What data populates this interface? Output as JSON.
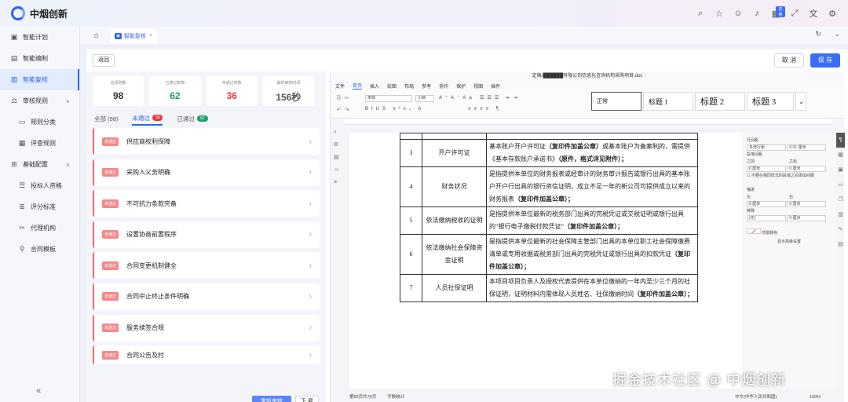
{
  "app": {
    "name": "中烟创新"
  },
  "header_icons": [
    "search-icon",
    "settings-icon",
    "chat-icon",
    "bell-icon",
    "apps-icon",
    "fullscreen-icon",
    "translate-icon",
    "gear-icon"
  ],
  "header_badge": "应用",
  "sidebar": {
    "items": [
      {
        "label": "智能计划",
        "icon": "book-icon"
      },
      {
        "label": "智能编制",
        "icon": "edit-icon"
      },
      {
        "label": "智能复核",
        "icon": "check-icon",
        "active": true
      },
      {
        "label": "审核规则",
        "icon": "rule-icon",
        "group": true
      },
      {
        "label": "规则分类",
        "icon": "list-icon",
        "sub": true
      },
      {
        "label": "评查规则",
        "icon": "doc-icon",
        "sub": true
      },
      {
        "label": "基础配置",
        "icon": "config-icon",
        "group": true
      },
      {
        "label": "投标人资格",
        "icon": "user-icon",
        "sub": true
      },
      {
        "label": "评分标准",
        "icon": "score-icon",
        "sub": true
      },
      {
        "label": "代理机构",
        "icon": "agency-icon",
        "sub": true
      },
      {
        "label": "合同模板",
        "icon": "contract-icon",
        "sub": true
      }
    ],
    "collapse_glyph": "«"
  },
  "tabs": [
    {
      "label": "智能复核"
    }
  ],
  "toolbar": {
    "back": "返回",
    "cancel": "取 消",
    "save": "保 存"
  },
  "stats": [
    {
      "label": "总规则数",
      "value": "98",
      "color": "#333333"
    },
    {
      "label": "已通过条数",
      "value": "62",
      "color": "#1e9e6a"
    },
    {
      "label": "未通过条数",
      "value": "36",
      "color": "#e5393b"
    },
    {
      "label": "最终审核时间",
      "value": "156秒",
      "color": "#555555"
    }
  ],
  "filters": [
    {
      "label": "全部 (98)",
      "badge": ""
    },
    {
      "label": "未通过",
      "badge": "36",
      "badge_color": "#e5393b",
      "active": true
    },
    {
      "label": "已通过",
      "badge": "62",
      "badge_color": "#1e9e6a"
    }
  ],
  "issue_tag": "未通过",
  "issues": [
    "供应商权利保障",
    "采购人义务明确",
    "不可抗力条款完备",
    "设置协商前置程序",
    "合同变更机制健全",
    "合同中止终止条件明确",
    "服务续签合规",
    "合同公告及时"
  ],
  "bottom_buttons": {
    "recheck": "重新审核",
    "next": "下 载"
  },
  "doc": {
    "title": "定稿-██████有限公司信息化咨询机构采购项目.doc",
    "menu": [
      "文件",
      "首页",
      "插入",
      "绘图",
      "布局",
      "参考",
      "协作",
      "保护",
      "视图",
      "插件"
    ],
    "menu_selected": 1,
    "font": "宋体",
    "size": "小四",
    "styles": [
      "正常",
      "标题 1",
      "标题 2",
      "标题 3"
    ],
    "rows": [
      {
        "num": "3",
        "name": "开户许可证",
        "desc": "基本账户开户许可证",
        "bold": "（复印件加盖公章）",
        "desc2": "或基本账户为备案制的，需提供《基本存款账户承诺书》",
        "bold2": "（原件，格式详见附件）；"
      },
      {
        "num": "4",
        "name": "财务状况",
        "desc": "是指提供本单位的财务报表或经审计的财务审计报告或银行出具的基本账户开户行出具的银行资信证明，成立不足一年的新公司可提供成立以来的财务报表",
        "bold": "（复印件加盖公章）；",
        "desc2": "",
        "bold2": ""
      },
      {
        "num": "5",
        "name": "依法缴纳税收的证明",
        "desc": "是指提供本单位最新的税务部门出具的完税凭证或交税证明或银行出具的“银行电子缴税付款凭证”",
        "bold": "（复印件加盖公章）；",
        "desc2": "",
        "bold2": ""
      },
      {
        "num": "6",
        "name": "依法缴纳社会保障资金证明",
        "desc": "是指提供本单位最新的社会保障主管部门出具的本单位职工社会保障缴费清单或专用收据或税务部门出具的完税凭证或银行出具的扣款凭证",
        "bold": "（复印件加盖公章）；",
        "desc2": "",
        "bold2": ""
      },
      {
        "num": "7",
        "name": "人员社保证明",
        "desc": "本项目项目负责人及授权代表提供在本单位缴纳的一年内至少三个月的社保证明，证明材料内需体现人员姓名、社保缴纳时间",
        "bold": "（复印件加盖公章）；",
        "desc2": "",
        "bold2": ""
      }
    ],
    "status_left": "第65页共76页",
    "status_words": "字数统计",
    "status_lang": "中文(中华人民共和国)",
    "status_zoom": "100%"
  },
  "props": {
    "title": "行间距",
    "line_type": "多倍行距",
    "line_value": "0.01 厘米",
    "para_title": "段落间距",
    "before_label": "之前",
    "after_label": "之后",
    "before": "0 厘米",
    "after": "0 厘米",
    "checkbox_label": "不要在相同样式的段落之间添加间隔",
    "indent_title": "缩进",
    "left_label": "左",
    "right_label": "右",
    "left": "0 厘米",
    "right": "0 厘米",
    "special_label": "特殊",
    "special": "(无)",
    "special_value": "0 厘米",
    "bg_label": "背景颜色",
    "advanced": "显示高级设置"
  },
  "watermark": "掘金技术社区 @ 中烟创新"
}
